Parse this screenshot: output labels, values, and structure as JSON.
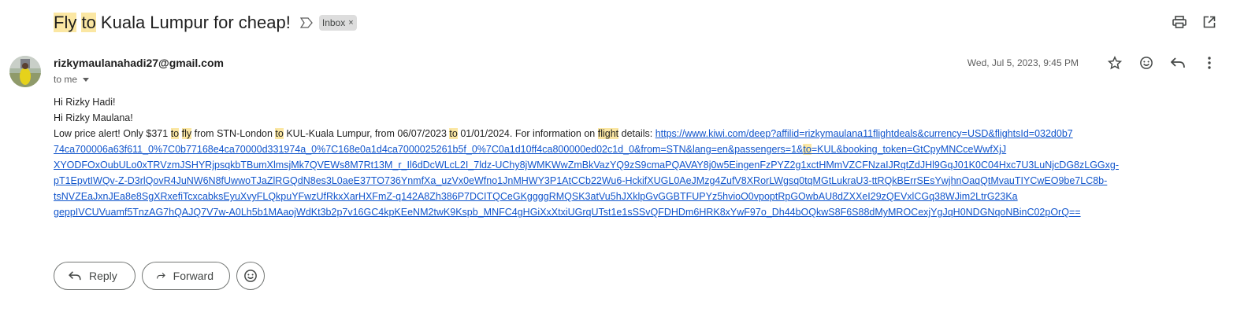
{
  "subject": {
    "parts": [
      {
        "text": "Fly",
        "highlight": true
      },
      {
        "text": " ",
        "highlight": false
      },
      {
        "text": "to",
        "highlight": true
      },
      {
        "text": " Kuala Lumpur for cheap!",
        "highlight": false
      }
    ],
    "label": "Inbox",
    "label_close": "×"
  },
  "sender": {
    "email": "rizkymaulanahadi27@gmail.com",
    "recipient": "to me",
    "date": "Wed, Jul 5, 2023, 9:45 PM"
  },
  "body": {
    "greeting1": "Hi Rizky Hadi!",
    "greeting2": "Hi Rizky Maulana!",
    "alert_parts": [
      {
        "text": "Low price alert! Only $371 ",
        "highlight": false
      },
      {
        "text": "to",
        "highlight": true
      },
      {
        "text": " ",
        "highlight": false
      },
      {
        "text": "fly",
        "highlight": true
      },
      {
        "text": " from STN-London ",
        "highlight": false
      },
      {
        "text": "to",
        "highlight": true
      },
      {
        "text": " KUL-Kuala Lumpur, from 06/07/2023 ",
        "highlight": false
      },
      {
        "text": "to",
        "highlight": true
      },
      {
        "text": " 01/01/2024. For information on ",
        "highlight": false
      },
      {
        "text": "flight",
        "highlight": true
      },
      {
        "text": " details: ",
        "highlight": false
      }
    ],
    "link_first": "https://www.kiwi.com/deep?affilid=rizkymaulana11flightdeals&currency=USD&flightsId=032d0b7",
    "link_line2_a": "74ca700006a63f611_0%7C0b77168e4ca70000d331974a_0%7C168e0a1d4ca7000025261b5f_0%7C0a1d10ff4ca800000ed02c1d_0&from=STN&lang=en&passengers=1&",
    "link_line2_hl": "to",
    "link_line2_b": "=KUL&booking_token=GtCpyMNCceWwfXjJ",
    "link_lines": [
      "XYODFOxOubULo0xTRVzmJSHYRjpsqkbTBumXlmsjMk7QVEWs8M7Rt13M_r_Il6dDcWLcL2I_7ldz-UChy8jWMKWwZmBkVazYQ9zS9cmaPQAVAY8j0w5EingenFzPYZ2g1xctHMmVZCFNzaIJRqtZdJHl9GqJ01K0C04Hxc7U3LuNjcDG8zLGGxg-",
      "pT1EpvtIWQv-Z-D3rlQovR4JuNW6N8fUwwoTJaZlRGQdN8es3L0aeE37TO736YnmfXa_uzVx0eWfno1JnMHWY3P1AtCCb22Wu6-HckifXUGL0AeJMzg4ZufV8XRorLWgsq0tqMGtLukraU3-ttRQkBErrSEsYwjhnOaqQtMvauTIYCwEO9be7LC8b-",
      "tsNVZEaJxnJEa8e8SgXRxefiTcxcabksEyuXvyFLQkpuYFwzUfRkxXarHXFmZ-q142A8Zh386P7DCITQCeGKggggRMQSK3atVu5hJXklpGvGGBTFUPYz5hvioO0vpoptRpGOwbAU8dZXXeI29zQEVxlCGq38WJim2LtrG23Ka",
      "geppIVCUVuamf5TnzAG7hQAJQ7V7w-A0Lh5b1MAaojWdKt3b2p7v16GC4kpKEeNM2twK9Kspb_MNFC4gHGiXxXtxiUGrqUTst1e1sSSvQFDHDm6HRK8xYwF97o_Dh44bOQkwS8F6S88dMyMROCexjYgJqH0NDGNqoNBinC02pOrQ=="
    ]
  },
  "actions": {
    "reply": "Reply",
    "forward": "Forward"
  },
  "colors": {
    "highlight": "#fbe7a3",
    "link": "#1155cc",
    "chip_bg": "#dddddd"
  },
  "icons": [
    "importance-marker-icon",
    "print-icon",
    "open-new-window-icon",
    "star-icon",
    "emoji-icon",
    "reply-icon",
    "more-vert-icon",
    "forward-icon"
  ]
}
